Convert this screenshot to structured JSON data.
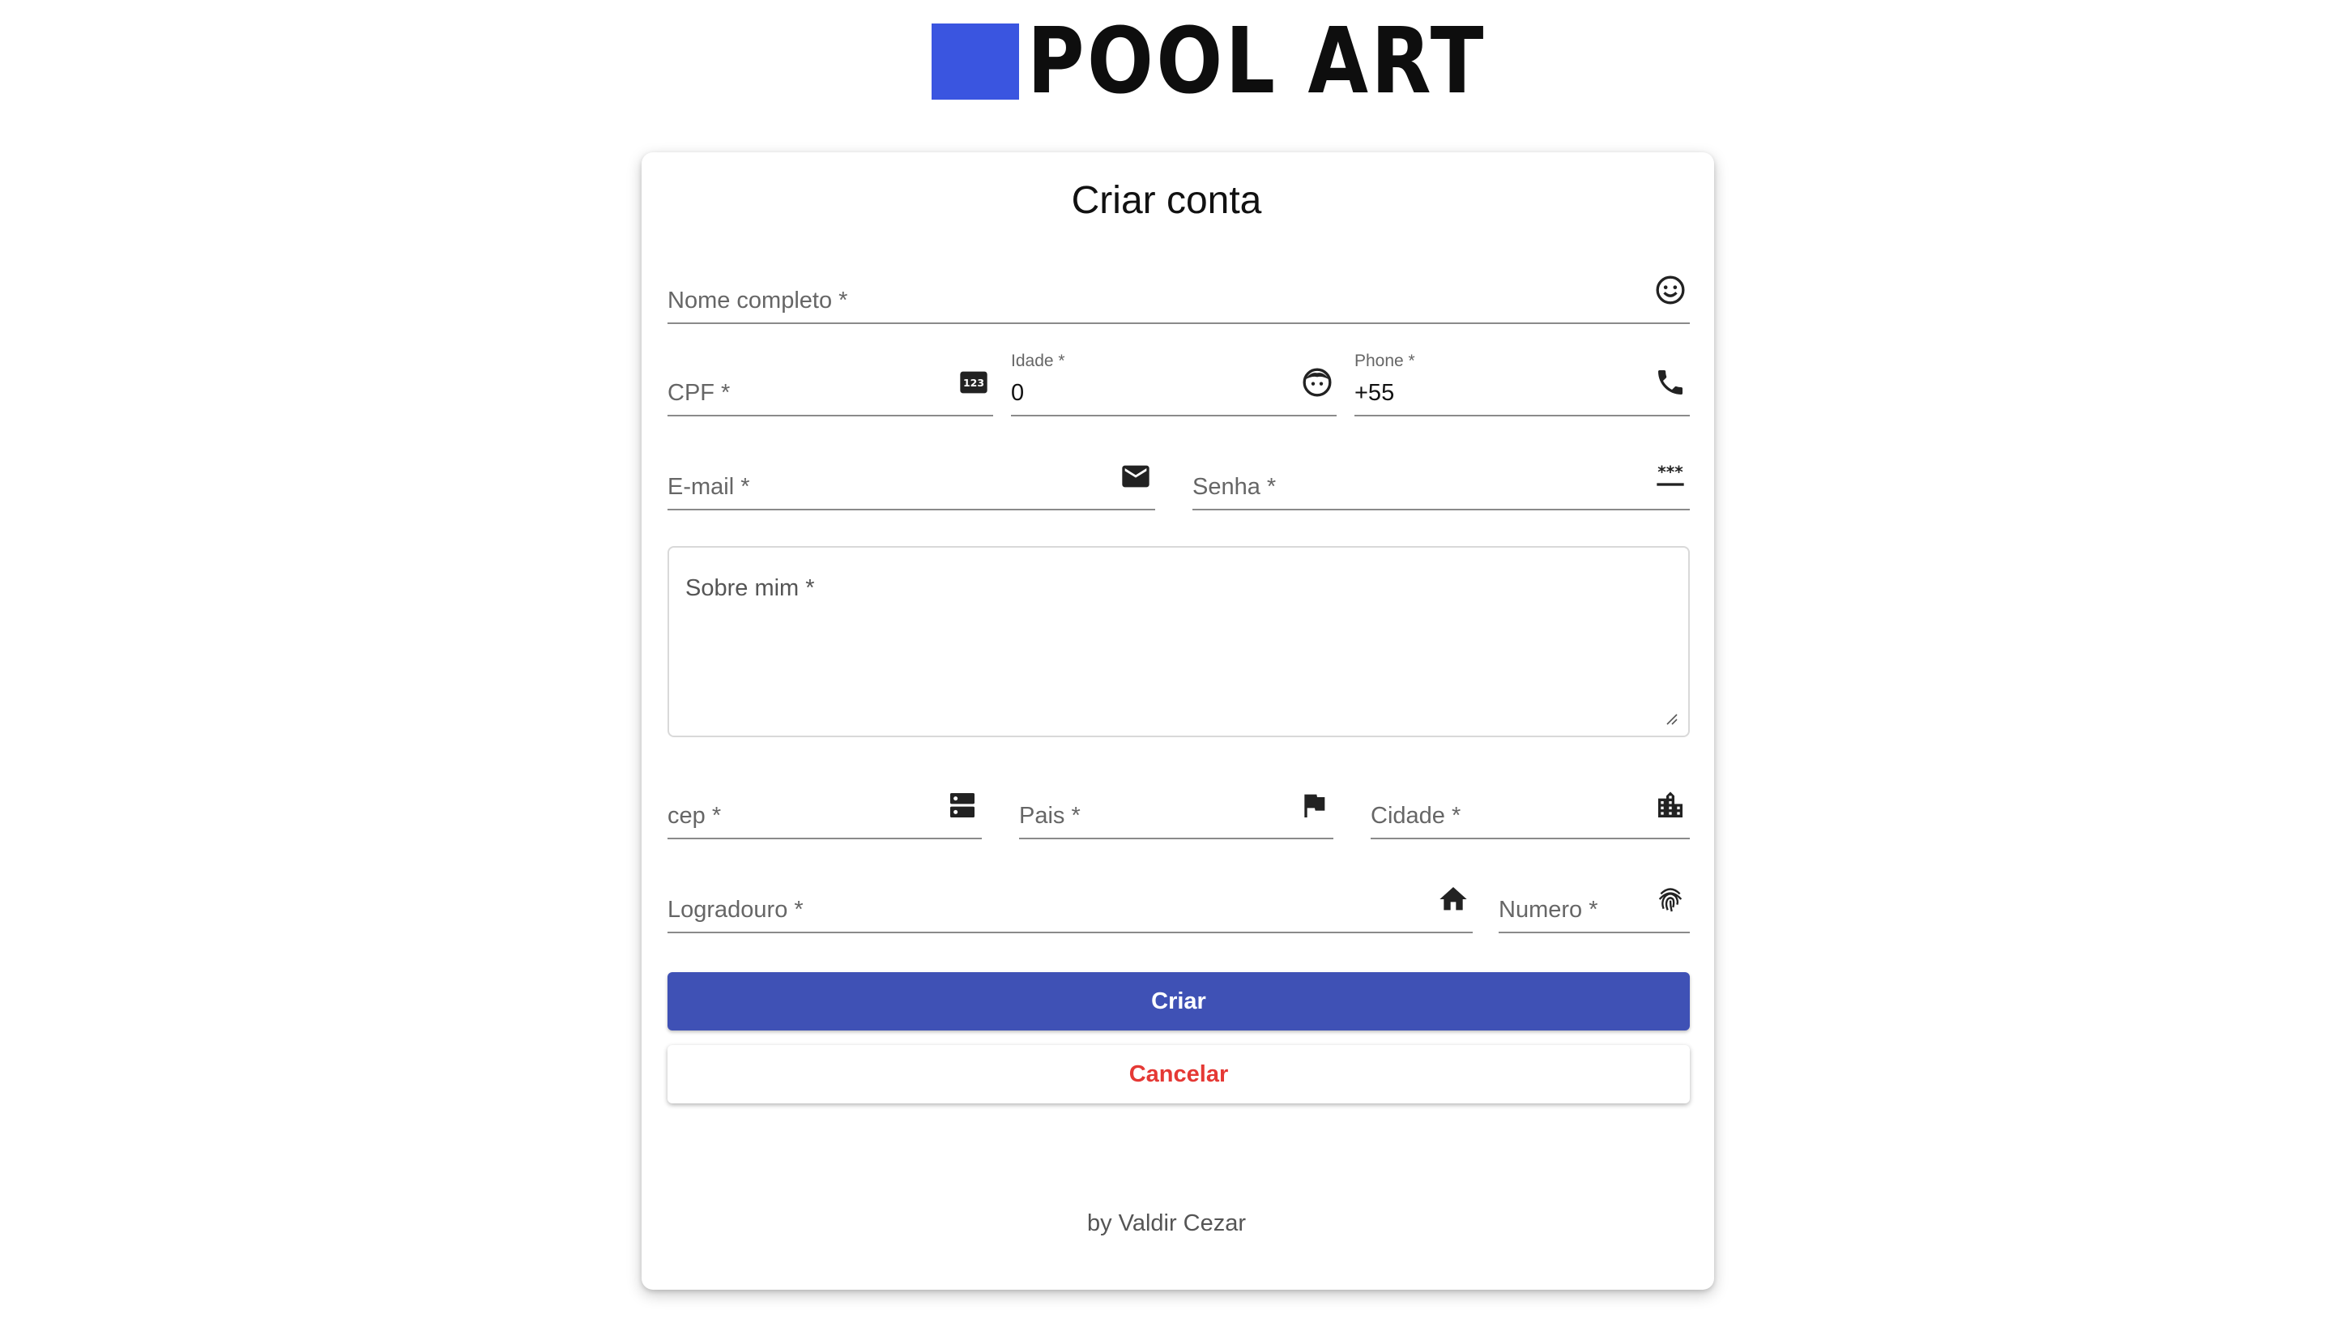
{
  "brand": {
    "name": "POOL ART",
    "color": "#3a55e0"
  },
  "form": {
    "title": "Criar conta",
    "fields": {
      "nome": {
        "label": "Nome completo *",
        "icon": "smiley-icon"
      },
      "cpf": {
        "label": "CPF *",
        "icon": "numbers-123-icon"
      },
      "idade": {
        "label": "Idade *",
        "value": "0",
        "icon": "face-icon"
      },
      "phone": {
        "label": "Phone *",
        "value": "+55",
        "icon": "phone-icon"
      },
      "email": {
        "label": "E-mail *",
        "icon": "mail-icon"
      },
      "senha": {
        "label": "Senha *",
        "icon": "password-icon"
      },
      "sobre": {
        "label": "Sobre mim *"
      },
      "cep": {
        "label": "cep *",
        "icon": "dns-icon"
      },
      "pais": {
        "label": "Pais *",
        "icon": "flag-icon"
      },
      "cidade": {
        "label": "Cidade *",
        "icon": "city-icon"
      },
      "logradouro": {
        "label": "Logradouro *",
        "icon": "home-icon"
      },
      "numero": {
        "label": "Numero *",
        "icon": "fingerprint-icon"
      }
    },
    "buttons": {
      "criar": "Criar",
      "cancelar": "Cancelar"
    },
    "colors": {
      "primary": "#3f51b5",
      "cancel": "#e53935"
    }
  },
  "footer": {
    "text": "by Valdir Cezar"
  }
}
